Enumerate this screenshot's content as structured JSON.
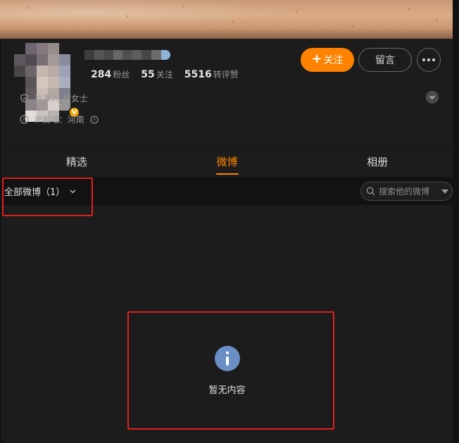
{
  "profile": {
    "verified_badge": "V",
    "stats": [
      {
        "value": "284",
        "label": "粉丝"
      },
      {
        "value": "55",
        "label": "关注"
      },
      {
        "value": "5516",
        "label": "转评赞"
      }
    ],
    "follow_label": "关注",
    "message_label": "留言",
    "identity_text": "当事人 胡女士",
    "ip_location": "IP属地：河南"
  },
  "tabs": [
    {
      "label": "精选",
      "active": false
    },
    {
      "label": "微博",
      "active": true
    },
    {
      "label": "相册",
      "active": false
    }
  ],
  "filter": {
    "dropdown_label": "全部微博（1）",
    "search_placeholder": "搜索他的微博"
  },
  "content": {
    "empty_text": "暂无内容"
  },
  "colors": {
    "accent": "#ff8200",
    "verified": "#f2a700",
    "info_icon": "#6a8fc4",
    "annotation": "#e0201b"
  }
}
